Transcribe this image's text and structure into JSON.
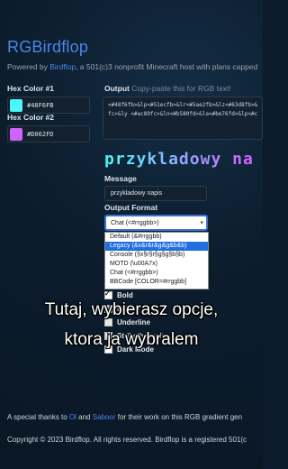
{
  "header": {
    "title": "RGBirdflop",
    "tagline_prefix": "Powered by ",
    "tagline_link": "Birdflop",
    "tagline_suffix": ", a 501(c)3 nonprofit Minecraft host with plans capped"
  },
  "colors": {
    "hex1_label": "Hex Color #1",
    "hex1_value": "#48F6FB",
    "hex1_swatch": "#48F6FB",
    "hex2_label": "Hex Color #2",
    "hex2_value": "#D062FD",
    "hex2_swatch": "#D062FD"
  },
  "output": {
    "label": "Output",
    "sublabel": "Copy-paste this for RGB text!",
    "lines": [
      "<#48f6fb>&lp<#51ecfb>&lr<#5ae2fb>&lz<#63d8fb>&",
      "fc>&ly <#ac89fc>&ln<#b580fd>&la<#be76fd>&lp<#c",
      ""
    ]
  },
  "preview": {
    "text": "przykladowy na",
    "gradient_start": "#48F6FB",
    "gradient_end": "#D062FD"
  },
  "message": {
    "label": "Message",
    "value": "przykladowy napis"
  },
  "output_format": {
    "label": "Output Format",
    "selected": "Chat (<#rrggbb>)",
    "options": [
      "Default (&#rrggbb)",
      "Legacy (&x&r&r&g&g&b&b)",
      "Console (§x§r§r§g§g§b§b)",
      "MOTD (\\u00A7x)",
      "Chat (<#rrggbb>)",
      "BBCode [COLOR=#rrggbb]"
    ],
    "highlighted_index": 1
  },
  "formatting": {
    "bold": "Bold",
    "italic": "Italic",
    "underline": "Underline",
    "strikethrough": "Strikethrough",
    "dark_mode": "Dark Mode"
  },
  "caption": {
    "line1": "Tutaj, wybierasz opcje,",
    "line2": "ktora ja wybralem"
  },
  "footer": {
    "thanks_prefix": "A special thanks to ",
    "thanks_link1": "Ol",
    "thanks_mid": " and ",
    "thanks_link2": "Saboor",
    "thanks_suffix": " for their work on this RGB gradient gen",
    "copyright": "Copyright © 2023 Birdflop. All rights reserved. Birdflop is a registered 501(c"
  }
}
